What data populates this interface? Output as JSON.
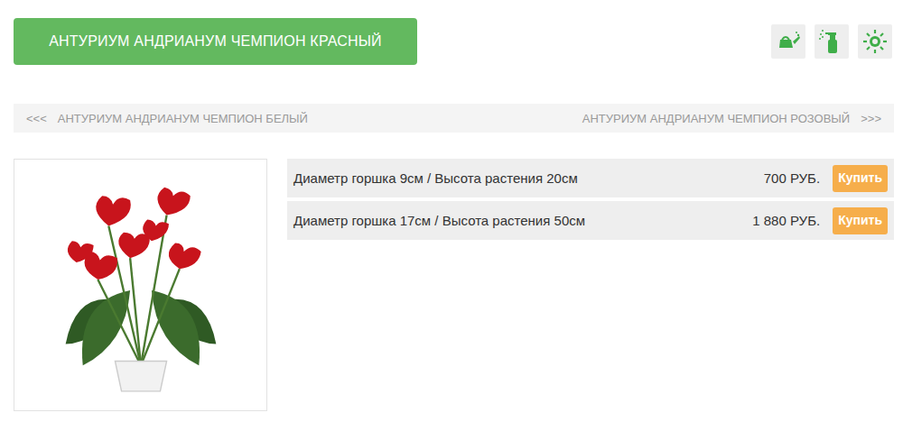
{
  "title": "АНТУРИУМ АНДРИАНУМ ЧЕМПИОН КРАСНЫЙ",
  "nav": {
    "prev": {
      "arrow": "<<<",
      "label": "АНТУРИУМ АНДРИАНУМ ЧЕМПИОН БЕЛЫЙ"
    },
    "next": {
      "label": "АНТУРИУМ АНДРИАНУМ ЧЕМПИОН РОЗОВЫЙ",
      "arrow": ">>>"
    }
  },
  "variants": [
    {
      "label": "Диаметр горшка 9см / Высота растения 20см",
      "price": "700 РУБ.",
      "button": "Купить"
    },
    {
      "label": "Диаметр горшка 17см / Высота растения 50см",
      "price": "1 880 РУБ.",
      "button": "Купить"
    }
  ]
}
